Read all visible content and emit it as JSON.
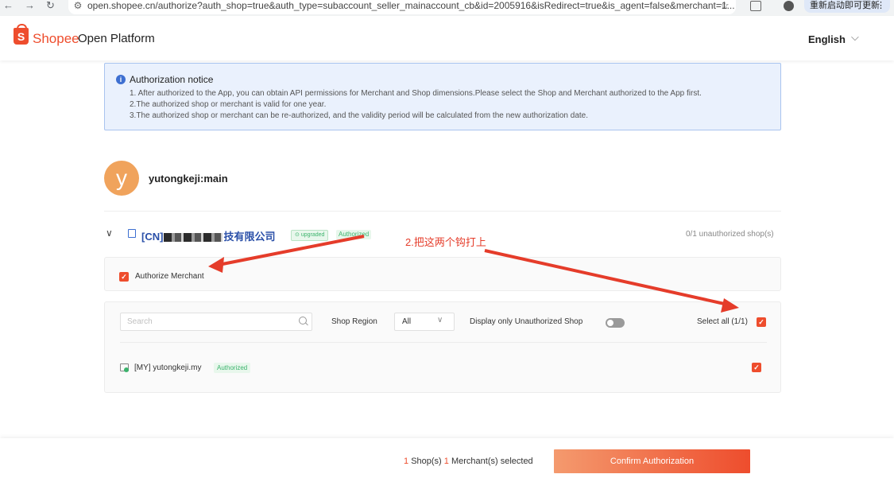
{
  "browser": {
    "back": "←",
    "forward": "→",
    "reload": "↻",
    "url": "open.shopee.cn/authorize?auth_shop=true&auth_type=subaccount_seller_mainaccount_cb&id=2005916&isRedirect=true&is_agent=false&merchant=1...",
    "update_label": "重新启动即可更新",
    "menu": "⋮"
  },
  "header": {
    "brand": "Shopee",
    "product": "Open Platform",
    "language": "English",
    "logo_letter": "S"
  },
  "notice": {
    "title": "Authorization notice",
    "lines": [
      "1. After authorized to the App, you can obtain API permissions for Merchant and Shop dimensions.Please select the Shop and Merchant authorized to the App first.",
      "2.The authorized shop or merchant is valid for one year.",
      "3.The authorized shop or merchant can be re-authorized, and the validity period will be calculated from the new authorization date."
    ]
  },
  "account": {
    "avatar_letter": "y",
    "name": "yutongkeji:main"
  },
  "merchant_group": {
    "name_prefix": "[CN]",
    "name_suffix": "技有限公司",
    "upgraded_label": "upgraded",
    "authorized_label": "Authorized",
    "unauthorized_count": "0/1 unauthorized shop(s)"
  },
  "annotation": "2.把这两个钩打上",
  "authorize_merchant": {
    "label": "Authorize Merchant",
    "checked": true
  },
  "filters": {
    "search_placeholder": "Search",
    "region_label": "Shop Region",
    "region_value": "All",
    "unauth_only_label": "Display only Unauthorized Shop",
    "unauth_only": false,
    "select_all_label": "Select all (1/1)",
    "select_all_checked": true
  },
  "shops": [
    {
      "name": "[MY] yutongkeji.my",
      "status": "Authorized",
      "checked": true
    }
  ],
  "footer": {
    "shop_count": "1",
    "shop_label": "Shop(s)",
    "merchant_count": "1",
    "merchant_label": "Merchant(s) selected",
    "confirm_label": "Confirm Authorization"
  },
  "colors": {
    "brand": "#ee4d2d",
    "annotation": "#e53c2a",
    "success": "#3bb36c",
    "info": "#3d6fd1"
  }
}
